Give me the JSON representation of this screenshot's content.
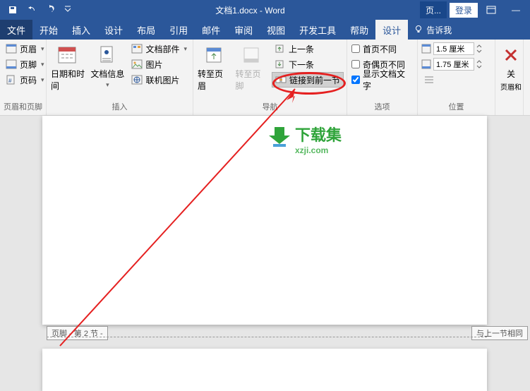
{
  "title": "文档1.docx - Word",
  "titlebar": {
    "page_tab": "页...",
    "login": "登录",
    "ribbon_options_icon": "ribbon-options-icon",
    "minimize": "—"
  },
  "tabs": {
    "file": "文件",
    "home": "开始",
    "insert": "插入",
    "design": "设计",
    "layout": "布局",
    "references": "引用",
    "mailings": "邮件",
    "review": "审阅",
    "view": "视图",
    "devtools": "开发工具",
    "help": "帮助",
    "hf_design": "设计",
    "tell_me": "告诉我"
  },
  "ribbon": {
    "hf_group": {
      "header": "页眉",
      "footer": "页脚",
      "page_number": "页码",
      "label": "页眉和页脚"
    },
    "insert_group": {
      "date_time": "日期和时间",
      "doc_info": "文档信息",
      "doc_parts": "文档部件",
      "picture": "图片",
      "online_picture": "联机图片",
      "label": "插入"
    },
    "nav_group": {
      "goto_header": "转至页眉",
      "goto_footer": "转至页脚",
      "previous": "上一条",
      "next": "下一条",
      "link_previous": "链接到前一节",
      "label": "导航"
    },
    "options_group": {
      "diff_first": "首页不同",
      "diff_odd_even": "奇偶页不同",
      "show_text": "显示文档文字",
      "label": "选项"
    },
    "position_group": {
      "top_val": "1.5 厘米",
      "bottom_val": "1.75 厘米",
      "label": "位置"
    },
    "close_group": {
      "close": "关",
      "sub": "页眉和"
    }
  },
  "doc": {
    "footer_label": "页脚 - 第 2 节 -",
    "same_as_prev": "与上一节相同"
  },
  "watermark": {
    "main": "下载集",
    "sub": "xzji.com"
  }
}
